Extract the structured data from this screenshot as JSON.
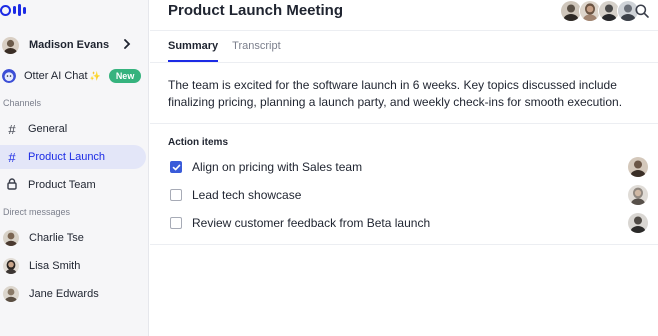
{
  "sidebar": {
    "logo": "otter-logo",
    "user": {
      "name": "Madison Evans",
      "avatar_color": "#6b5a4a"
    },
    "otter_chat": {
      "label": "Otter AI Chat",
      "sparkle": "✨",
      "badge": "New"
    },
    "channels_heading": "Channels",
    "channels": [
      {
        "label": "General",
        "icon": "hash-icon",
        "active": false
      },
      {
        "label": "Product Launch",
        "icon": "hash-icon",
        "active": true
      },
      {
        "label": "Product Team",
        "icon": "lock-icon",
        "active": false
      }
    ],
    "dm_heading": "Direct messages",
    "direct_messages": [
      {
        "label": "Charlie Tse",
        "avatar_color": "#7a6552"
      },
      {
        "label": "Lisa Smith",
        "avatar_color": "#3c3633"
      },
      {
        "label": "Jane Edwards",
        "avatar_color": "#8a7a68"
      }
    ]
  },
  "main": {
    "title": "Product Launch Meeting",
    "participants": [
      "#5a5046",
      "#a08470",
      "#4a4a4a",
      "#6a6f78"
    ],
    "tabs": [
      {
        "label": "Summary",
        "active": true
      },
      {
        "label": "Transcript",
        "active": false
      }
    ],
    "summary": "The team is excited for the software launch in 6 weeks. Key topics discussed include finalizing pricing, planning a launch party, and weekly check-ins for smooth execution.",
    "action_items_title": "Action items",
    "action_items": [
      {
        "label": "Align on pricing with Sales team",
        "checked": true,
        "assignee_color": "#6b5646"
      },
      {
        "label": "Lead tech showcase",
        "checked": false,
        "assignee_color": "#8f877f"
      },
      {
        "label": "Review customer feedback from Beta launch",
        "checked": false,
        "assignee_color": "#4f4a45"
      }
    ]
  },
  "colors": {
    "accent": "#1c2be5",
    "badge_green": "#36b37e",
    "active_nav_bg": "#e3e6f8",
    "checkbox_blue": "#3a5bd9"
  }
}
